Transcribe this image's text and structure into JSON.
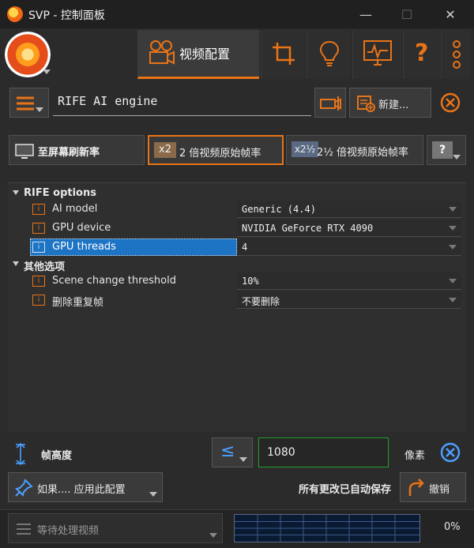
{
  "window": {
    "title": "SVP - 控制面板",
    "minimize": "—",
    "maximize": "☐",
    "close": "✕"
  },
  "toolbar": {
    "video_config_label": "视频配置",
    "help_glyph": "?"
  },
  "profile": {
    "name": "RIFE AI engine",
    "new_label": "新建..."
  },
  "modes": {
    "refresh_label": "至屏幕刷新率",
    "double_label": "2 倍视频原始帧率",
    "double_icon_text": "x2",
    "twohalf_label": "2½ 倍视频原始帧率",
    "twohalf_icon_text": "x2½",
    "selected": "double"
  },
  "options": {
    "group1": {
      "label": "RIFE options",
      "items": [
        {
          "label": "AI model",
          "value": "Generic (4.4)"
        },
        {
          "label": "GPU device",
          "value": "NVIDIA GeForce RTX 4090"
        },
        {
          "label": "GPU threads",
          "value": "4"
        }
      ]
    },
    "group2": {
      "label": "其他选项",
      "items": [
        {
          "label": "Scene change threshold",
          "value": "10%"
        },
        {
          "label": "删除重复帧",
          "value": "不要删除"
        }
      ]
    },
    "selected_item": "GPU threads"
  },
  "frame_height": {
    "label": "帧高度",
    "compare": "≤",
    "value": "1080",
    "unit": "像素"
  },
  "bottom": {
    "apply_if_label": "如果.... 应用此配置",
    "autosave_label": "所有更改已自动保存",
    "undo_label": "撤销"
  },
  "status": {
    "queue_label": "等待处理视频",
    "load_percent": "0%"
  },
  "colors": {
    "accent": "#e97417",
    "selection": "#1e74c4",
    "input_border": "#22a02a"
  }
}
